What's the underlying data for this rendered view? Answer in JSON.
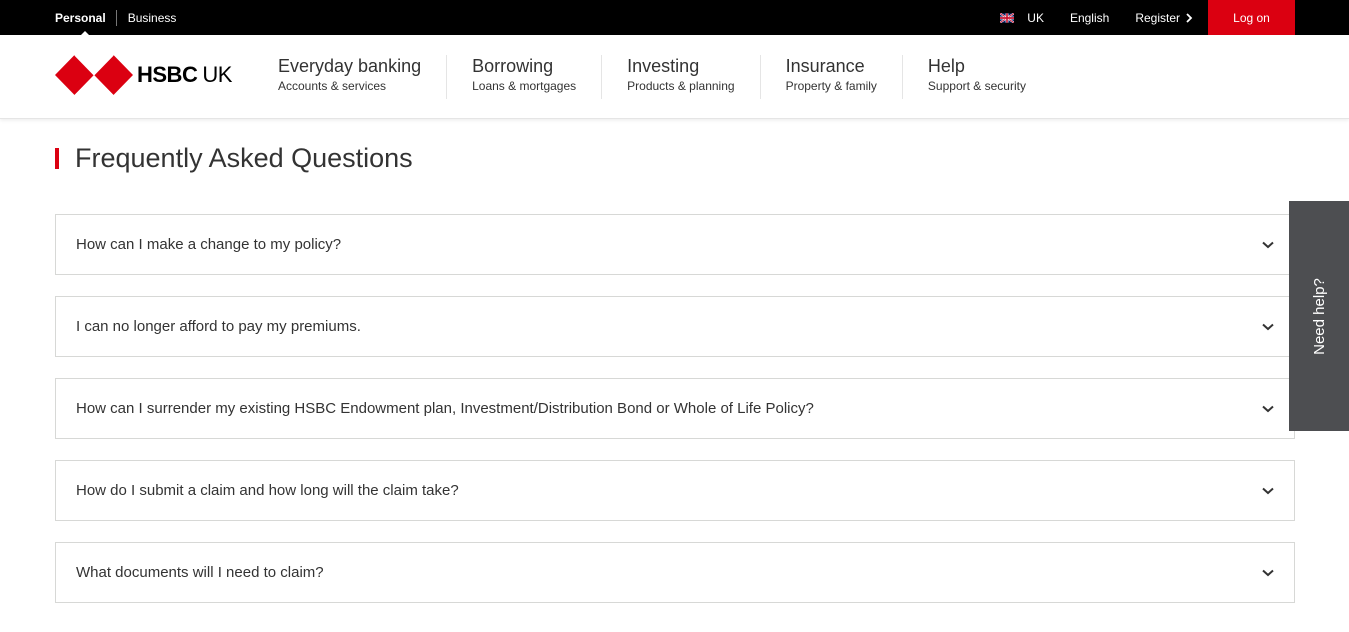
{
  "topbar": {
    "personal": "Personal",
    "business": "Business",
    "region": "UK",
    "language": "English",
    "register": "Register",
    "logon": "Log on"
  },
  "logo": {
    "brand": "HSBC",
    "country": "UK"
  },
  "nav": [
    {
      "title": "Everyday banking",
      "sub": "Accounts & services"
    },
    {
      "title": "Borrowing",
      "sub": "Loans & mortgages"
    },
    {
      "title": "Investing",
      "sub": "Products & planning"
    },
    {
      "title": "Insurance",
      "sub": "Property & family"
    },
    {
      "title": "Help",
      "sub": "Support & security"
    }
  ],
  "page": {
    "title": "Frequently Asked Questions"
  },
  "faq": [
    "How can I make a change to my policy?",
    "I can no longer afford to pay my premiums.",
    "How can I surrender my existing HSBC Endowment plan, Investment/Distribution Bond or Whole of Life Policy?",
    "How do I submit a claim and how long will the claim take?",
    "What documents will I need to claim?"
  ],
  "need_help": "Need help?",
  "colors": {
    "brand_red": "#db0011",
    "topbar_bg": "#000000",
    "help_tab_bg": "#4d4e51"
  },
  "icons": {
    "flag": "uk-flag-icon",
    "register_chevron": "chevron-right-icon",
    "faq_chevron": "chevron-down-icon",
    "logo": "hsbc-hexagon-logo"
  }
}
